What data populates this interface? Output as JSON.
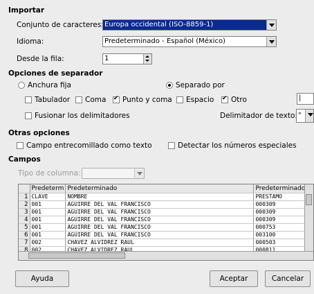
{
  "import": {
    "heading": "Importar",
    "charset_label": "Conjunto de caracteres:",
    "charset_value": "Europa occidental (ISO-8859-1)",
    "language_label": "Idioma:",
    "language_value": "Predeterminado - Español (México)",
    "from_row_label": "Desde la fila:",
    "from_row_value": "1"
  },
  "separator": {
    "heading": "Opciones de separador",
    "fixed_width_label": "Anchura fija",
    "separated_by_label": "Separado por",
    "separated_by_selected": true,
    "tab_label": "Tabulador",
    "tab_checked": false,
    "comma_label": "Coma",
    "comma_checked": false,
    "semicolon_label": "Punto y coma",
    "semicolon_checked": true,
    "space_label": "Espacio",
    "space_checked": false,
    "other_label": "Otro",
    "other_checked": true,
    "other_value": "|",
    "merge_label": "Fusionar los delimitadores",
    "merge_checked": false,
    "text_delimiter_label": "Delimitador de texto:",
    "text_delimiter_value": "\""
  },
  "other_options": {
    "heading": "Otras opciones",
    "quoted_as_text_label": "Campo entrecomillado como texto",
    "quoted_as_text_checked": false,
    "detect_special_label": "Detectar los números especiales",
    "detect_special_checked": false
  },
  "fields": {
    "heading": "Campos",
    "column_type_label": "Tipo de columna:",
    "column_type_value": "",
    "headers": [
      "Predeterm",
      "Predeterminado",
      "Predeterminado"
    ],
    "rows": [
      {
        "n": "1",
        "c1": "CLAVE",
        "c2": "NOMBRE",
        "c3": "PRESTAMO"
      },
      {
        "n": "2",
        "c1": "001",
        "c2": "AGUIRRE DEL VAL FRANCISCO",
        "c3": "000309"
      },
      {
        "n": "3",
        "c1": "001",
        "c2": "AGUIRRE DEL VAL FRANCISCO",
        "c3": "000309"
      },
      {
        "n": "4",
        "c1": "001",
        "c2": "AGUIRRE DEL VAL FRANCISCO",
        "c3": "000309"
      },
      {
        "n": "5",
        "c1": "001",
        "c2": "AGUIRRE DEL VAL FRANCISCO",
        "c3": "000753"
      },
      {
        "n": "6",
        "c1": "001",
        "c2": "AGUIRRE DEL VAL FRANCISCO",
        "c3": "003100"
      },
      {
        "n": "7",
        "c1": "002",
        "c2": "CHAVEZ ALVIDREZ RAUL",
        "c3": "000503"
      },
      {
        "n": "8",
        "c1": "002",
        "c2": "CHAVEZ ALVIDREZ RAUL",
        "c3": "000811"
      }
    ]
  },
  "buttons": {
    "help": "Ayuda",
    "accept": "Aceptar",
    "cancel": "Cancelar"
  }
}
